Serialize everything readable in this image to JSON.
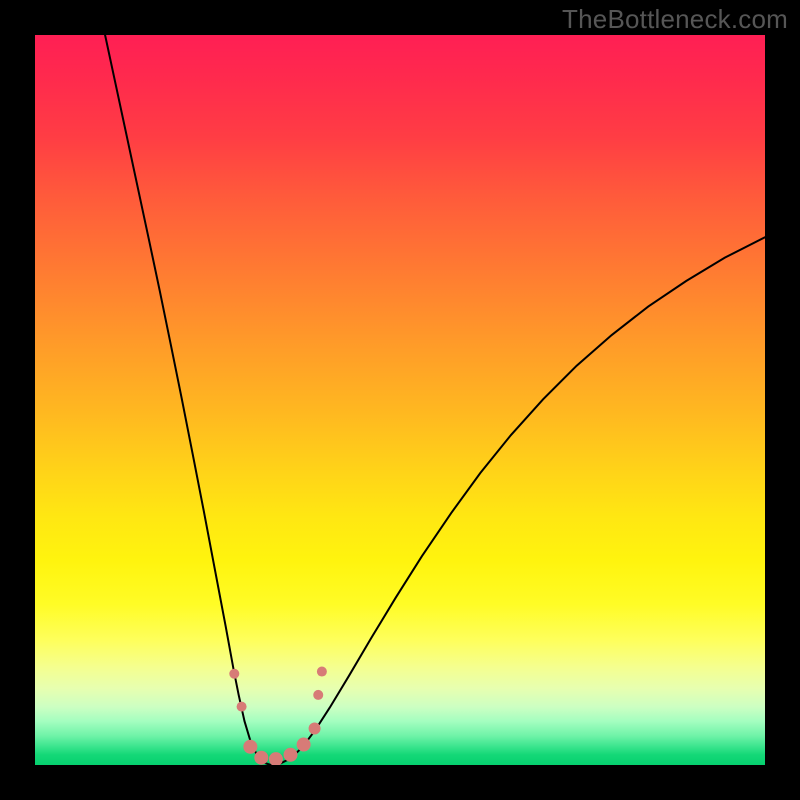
{
  "watermark": "TheBottleneck.com",
  "chart_data": {
    "type": "line",
    "title": "",
    "xlabel": "",
    "ylabel": "",
    "xlim": [
      0,
      100
    ],
    "ylim": [
      0,
      100
    ],
    "curves": [
      {
        "name": "left-branch",
        "points": [
          {
            "x": 9.6,
            "y": 100.0
          },
          {
            "x": 11.1,
            "y": 93.0
          },
          {
            "x": 12.6,
            "y": 86.0
          },
          {
            "x": 14.1,
            "y": 79.0
          },
          {
            "x": 15.6,
            "y": 72.0
          },
          {
            "x": 17.1,
            "y": 64.9
          },
          {
            "x": 18.6,
            "y": 57.6
          },
          {
            "x": 20.1,
            "y": 50.2
          },
          {
            "x": 21.6,
            "y": 42.6
          },
          {
            "x": 23.1,
            "y": 34.9
          },
          {
            "x": 24.6,
            "y": 27.0
          },
          {
            "x": 26.1,
            "y": 19.1
          },
          {
            "x": 27.2,
            "y": 13.1
          },
          {
            "x": 27.9,
            "y": 9.6
          },
          {
            "x": 28.7,
            "y": 6.0
          },
          {
            "x": 29.6,
            "y": 3.0
          },
          {
            "x": 30.5,
            "y": 1.2
          },
          {
            "x": 31.4,
            "y": 0.3
          },
          {
            "x": 32.3,
            "y": 0.0
          }
        ]
      },
      {
        "name": "right-branch",
        "points": [
          {
            "x": 32.3,
            "y": 0.0
          },
          {
            "x": 33.6,
            "y": 0.2
          },
          {
            "x": 35.0,
            "y": 0.9
          },
          {
            "x": 36.6,
            "y": 2.4
          },
          {
            "x": 38.4,
            "y": 4.8
          },
          {
            "x": 40.4,
            "y": 7.9
          },
          {
            "x": 43.0,
            "y": 12.2
          },
          {
            "x": 46.0,
            "y": 17.3
          },
          {
            "x": 49.4,
            "y": 22.9
          },
          {
            "x": 53.0,
            "y": 28.6
          },
          {
            "x": 57.0,
            "y": 34.5
          },
          {
            "x": 61.0,
            "y": 40.0
          },
          {
            "x": 65.2,
            "y": 45.2
          },
          {
            "x": 69.6,
            "y": 50.1
          },
          {
            "x": 74.2,
            "y": 54.7
          },
          {
            "x": 79.0,
            "y": 58.9
          },
          {
            "x": 84.0,
            "y": 62.8
          },
          {
            "x": 89.2,
            "y": 66.3
          },
          {
            "x": 94.5,
            "y": 69.5
          },
          {
            "x": 100.0,
            "y": 72.3
          }
        ]
      }
    ],
    "data_points": [
      {
        "x": 27.3,
        "y": 12.5,
        "r": 5
      },
      {
        "x": 28.3,
        "y": 8.0,
        "r": 5
      },
      {
        "x": 29.5,
        "y": 2.5,
        "r": 7
      },
      {
        "x": 31.0,
        "y": 1.0,
        "r": 7
      },
      {
        "x": 33.0,
        "y": 0.8,
        "r": 7
      },
      {
        "x": 35.0,
        "y": 1.4,
        "r": 7
      },
      {
        "x": 36.8,
        "y": 2.8,
        "r": 7
      },
      {
        "x": 38.3,
        "y": 5.0,
        "r": 6
      },
      {
        "x": 38.8,
        "y": 9.6,
        "r": 5
      },
      {
        "x": 39.3,
        "y": 12.8,
        "r": 5
      }
    ]
  }
}
